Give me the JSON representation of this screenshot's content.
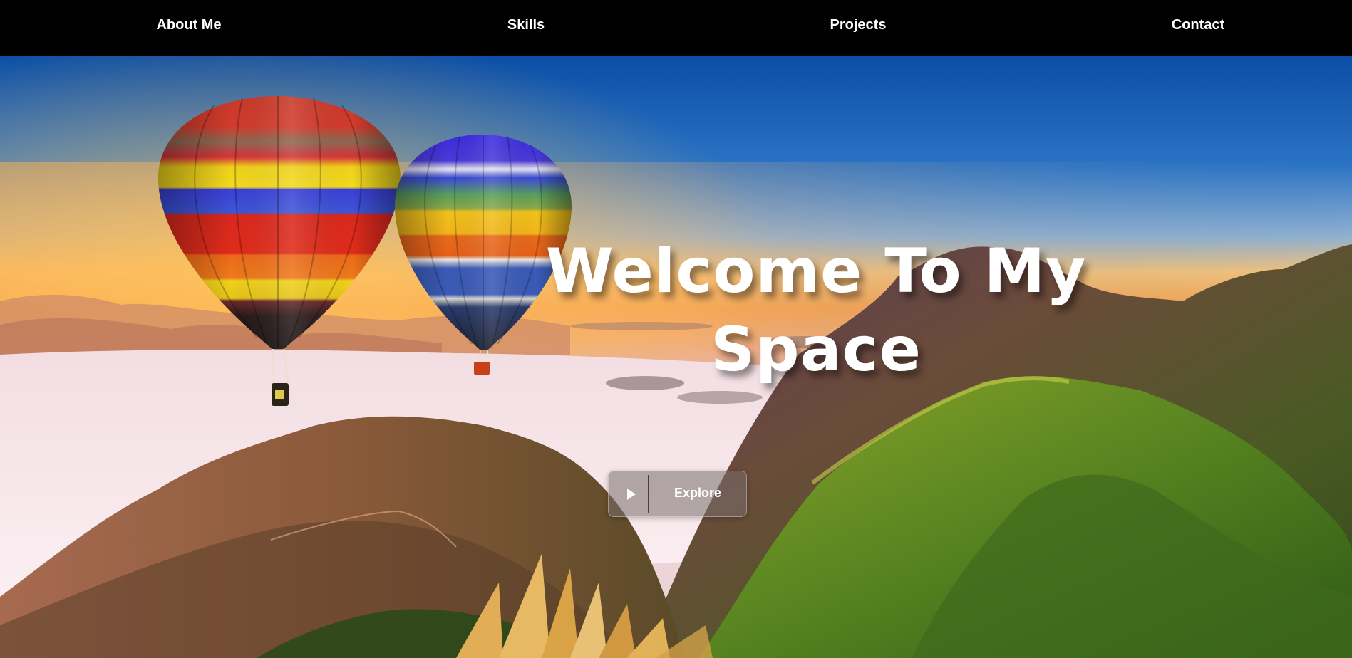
{
  "nav": {
    "items": [
      {
        "label": "About Me"
      },
      {
        "label": "Skills"
      },
      {
        "label": "Projects"
      },
      {
        "label": "Contact"
      }
    ]
  },
  "hero": {
    "title": "Welcome To My Space",
    "explore_label": "Explore",
    "background_image": "hot-air-balloons-over-mountains-at-sunrise"
  },
  "colors": {
    "nav_bg": "#000000",
    "text": "#ffffff",
    "sky_top": "#0a4fa6",
    "sunrise": "#f5a24a"
  },
  "icons": {
    "explore": "play-icon"
  }
}
